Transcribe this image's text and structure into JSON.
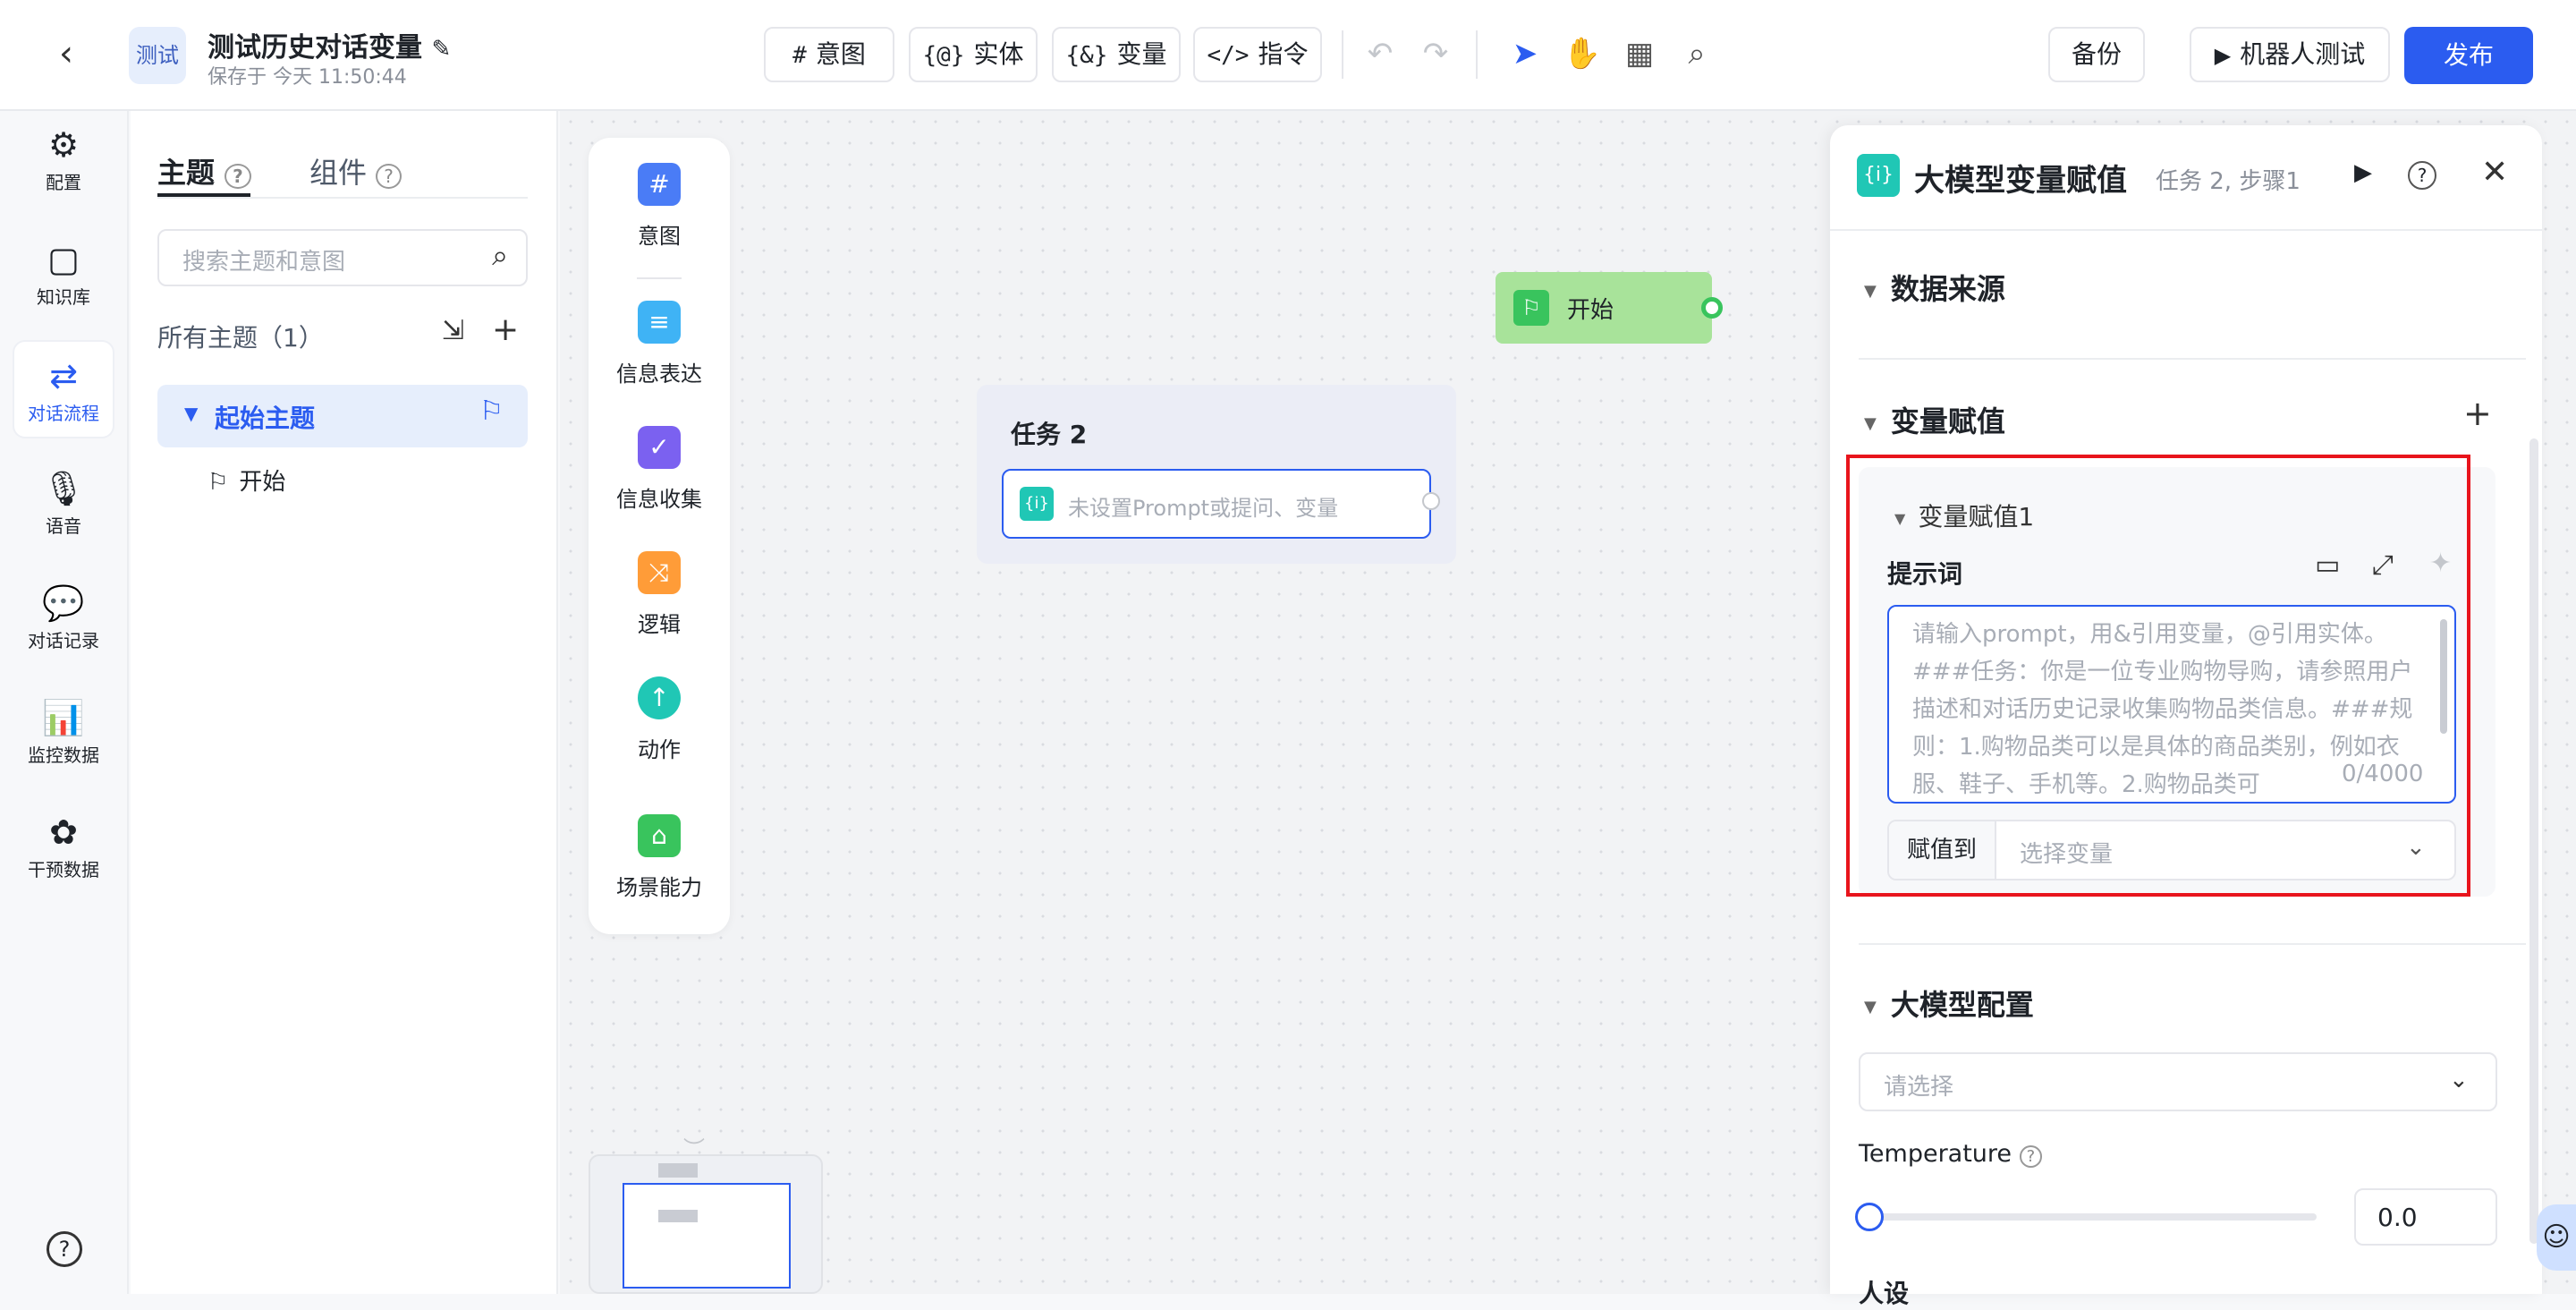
{
  "header": {
    "back_icon": "‹",
    "badge": "测试",
    "title": "测试历史对话变量",
    "edit_icon": "✎",
    "saved": "保存于 今天 11:50:44",
    "tools": [
      {
        "icon": "#",
        "label": "意图"
      },
      {
        "icon": "{@}",
        "label": "实体"
      },
      {
        "icon": "{&}",
        "label": "变量"
      },
      {
        "icon": "</>",
        "label": "指令"
      }
    ],
    "backup": "备份",
    "test": "机器人测试",
    "publish": "发布"
  },
  "nav": [
    {
      "icon": "⚙",
      "label": "配置"
    },
    {
      "icon": "▢",
      "label": "知识库"
    },
    {
      "icon": "⇄",
      "label": "对话流程"
    },
    {
      "icon": "🎙",
      "label": "语音"
    },
    {
      "icon": "💬",
      "label": "对话记录"
    },
    {
      "icon": "📊",
      "label": "监控数据"
    },
    {
      "icon": "✿",
      "label": "干预数据"
    }
  ],
  "help_icon": "?",
  "topics": {
    "tab_topic": "主题",
    "tab_component": "组件",
    "search_placeholder": "搜索主题和意图",
    "all_label": "所有主题（1）",
    "start_topic": "起始主题",
    "start_item": "开始"
  },
  "palette": [
    {
      "icon": "#",
      "label": "意图",
      "color": "#4a7cf6"
    },
    {
      "icon": "≡",
      "label": "信息表达",
      "color": "#3fb3f5"
    },
    {
      "icon": "✓",
      "label": "信息收集",
      "color": "#7b61f0"
    },
    {
      "icon": "⤨",
      "label": "逻辑",
      "color": "#ff9c38"
    },
    {
      "icon": "↑",
      "label": "动作",
      "color": "#20c7b5"
    },
    {
      "icon": "⌂",
      "label": "场景能力",
      "color": "#39c45d"
    }
  ],
  "canvas": {
    "start_node": "开始",
    "task_title": "任务 2",
    "task_step_placeholder": "未设置Prompt或提问、变量"
  },
  "drawer": {
    "title": "大模型变量赋值",
    "subtitle": "任务 2, 步骤1",
    "section_source": "数据来源",
    "section_assign": "变量赋值",
    "assign_item": "变量赋值1",
    "prompt_label": "提示词",
    "prompt_placeholder": "请输入prompt，用&引用变量，@引用实体。###任务：你是一位专业购物导购，请参照用户描述和对话历史记录收集购物品类信息。###规则：1.购物品类可以是具体的商品类别，例如衣服、鞋子、手机等。2.购物品类可",
    "char_count": "0/4000",
    "assign_to": "赋值到",
    "select_var": "选择变量",
    "section_model": "大模型配置",
    "model_placeholder": "请选择",
    "temperature_label": "Temperature",
    "temperature_value": "0.0",
    "persona_label": "人设"
  }
}
